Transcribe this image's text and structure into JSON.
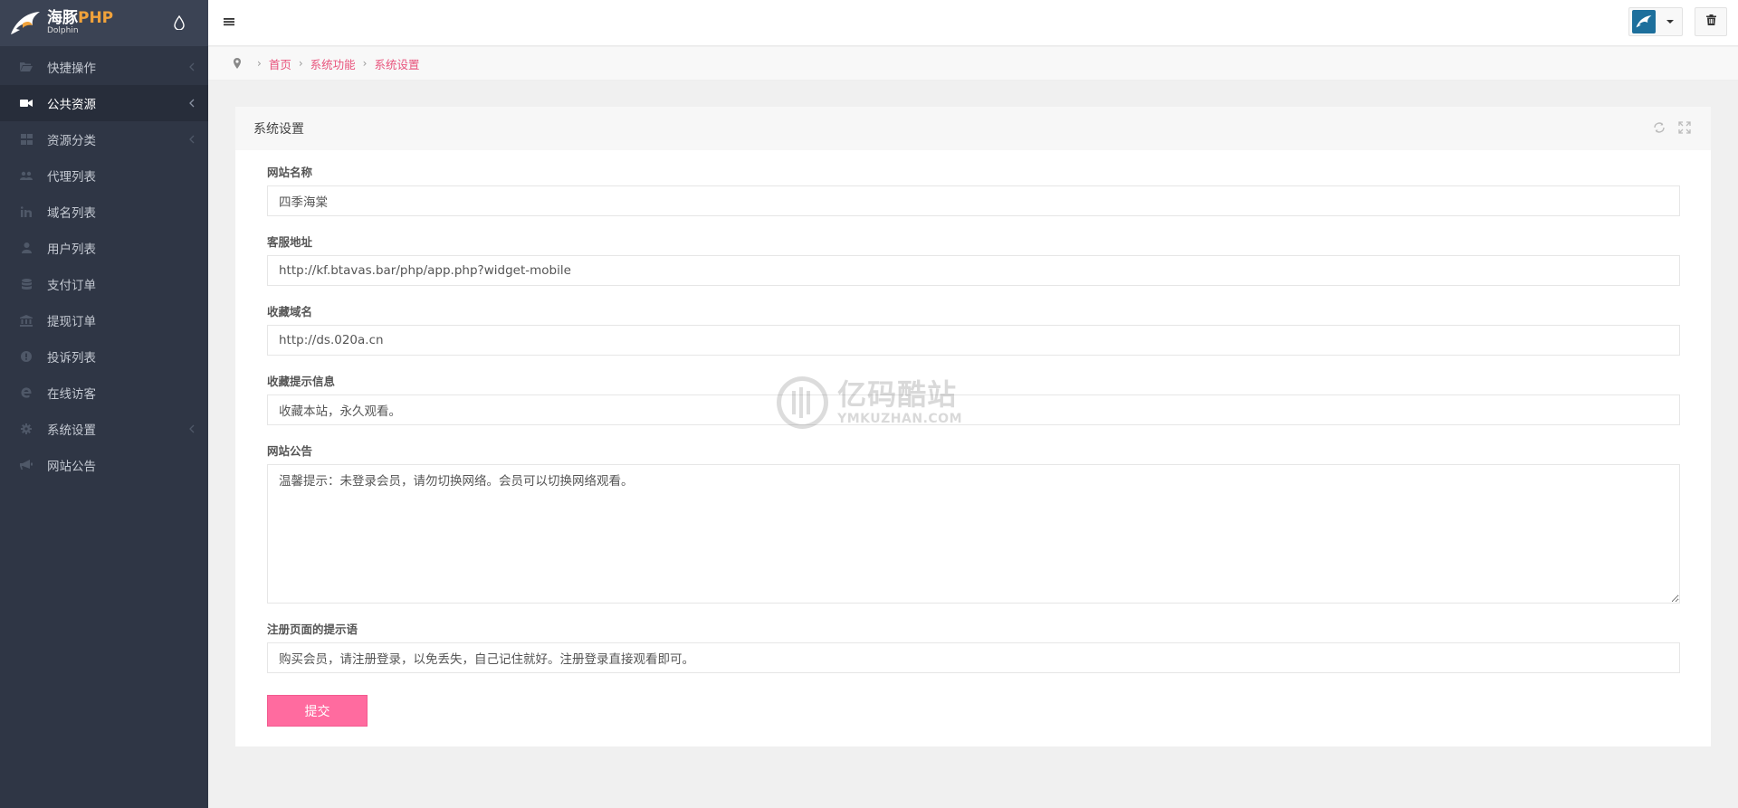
{
  "brand": {
    "name": "海豚",
    "name_accent": "PHP",
    "sub": "Dolphin"
  },
  "sidebar": {
    "items": [
      {
        "label": "快捷操作",
        "icon": "folder-open-icon",
        "has_arrow": true,
        "active": false
      },
      {
        "label": "公共资源",
        "icon": "video-camera-icon",
        "has_arrow": true,
        "active": true
      },
      {
        "label": "资源分类",
        "icon": "grid-icon",
        "has_arrow": true,
        "active": false
      },
      {
        "label": "代理列表",
        "icon": "users-icon",
        "has_arrow": false,
        "active": false
      },
      {
        "label": "域名列表",
        "icon": "linkedin-icon",
        "has_arrow": false,
        "active": false
      },
      {
        "label": "用户列表",
        "icon": "user-icon",
        "has_arrow": false,
        "active": false
      },
      {
        "label": "支付订单",
        "icon": "database-icon",
        "has_arrow": false,
        "active": false
      },
      {
        "label": "提现订单",
        "icon": "bank-icon",
        "has_arrow": false,
        "active": false
      },
      {
        "label": "投诉列表",
        "icon": "exclamation-circle-icon",
        "has_arrow": false,
        "active": false
      },
      {
        "label": "在线访客",
        "icon": "internet-explorer-icon",
        "has_arrow": false,
        "active": false
      },
      {
        "label": "系统设置",
        "icon": "gear-icon",
        "has_arrow": true,
        "active": false
      },
      {
        "label": "网站公告",
        "icon": "bullhorn-icon",
        "has_arrow": false,
        "active": false
      }
    ]
  },
  "breadcrumb": {
    "items": [
      "首页",
      "系统功能",
      "系统设置"
    ]
  },
  "panel": {
    "title": "系统设置"
  },
  "form": {
    "site_name": {
      "label": "网站名称",
      "value": "四季海棠"
    },
    "service_url": {
      "label": "客服地址",
      "value": "http://kf.btavas.bar/php/app.php?widget-mobile"
    },
    "bookmark_domain": {
      "label": "收藏域名",
      "value": "http://ds.020a.cn"
    },
    "bookmark_tip": {
      "label": "收藏提示信息",
      "value": "收藏本站，永久观看。"
    },
    "announcement": {
      "label": "网站公告",
      "value": "温馨提示：未登录会员，请勿切换网络。会员可以切换网络观看。"
    },
    "register_tip": {
      "label": "注册页面的提示语",
      "value": "购买会员，请注册登录，以免丢失，自己记住就好。注册登录直接观看即可。"
    },
    "submit_label": "提交"
  },
  "watermark": {
    "cn": "亿码酷站",
    "en": "YMKUZHAN.COM"
  },
  "colors": {
    "sidebar": "#2f3645",
    "accent": "#ff6b9f",
    "link": "#e8537c",
    "brand_accent": "#f0a23b"
  }
}
